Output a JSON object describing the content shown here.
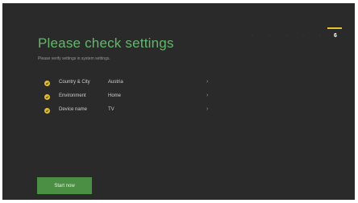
{
  "header": {
    "title": "Please check settings",
    "subtitle": "Please verify settings in system settings."
  },
  "steps": {
    "items": [
      "·",
      "·",
      "·",
      "·",
      "·",
      "6"
    ],
    "current_label": "6",
    "accent_color": "#e5c52a"
  },
  "settings": [
    {
      "label": "Country & City",
      "value": "Austria",
      "chevron": "›",
      "icon": "check-circle-icon"
    },
    {
      "label": "Environment",
      "value": "Home",
      "chevron": "›",
      "icon": "check-circle-icon"
    },
    {
      "label": "Device name",
      "value": "TV",
      "chevron": "›",
      "icon": "check-circle-icon"
    }
  ],
  "actions": {
    "start_label": "Start now"
  },
  "colors": {
    "background": "#2a2a2a",
    "title": "#63b86b",
    "check": "#e0c227",
    "button": "#4b8f45"
  }
}
